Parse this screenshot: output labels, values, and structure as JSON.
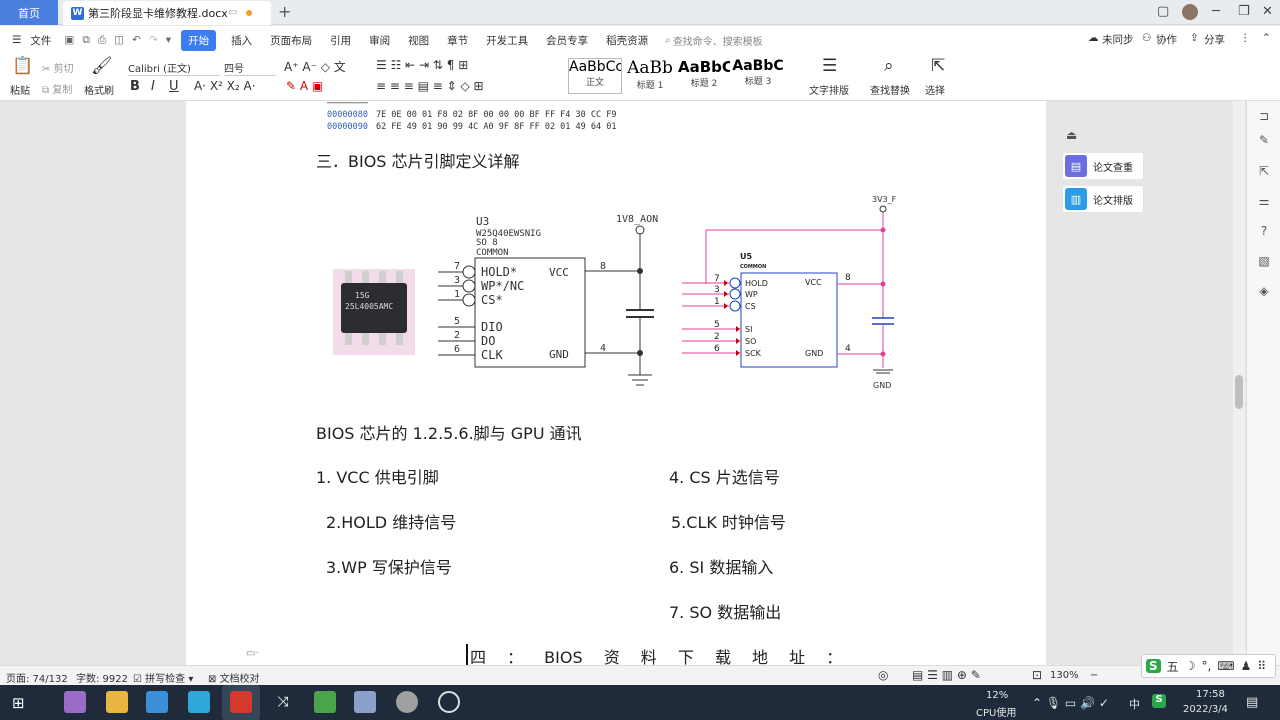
{
  "titlebar": {
    "home_tab": "首页",
    "doc_tab": "第三阶段显卡维修教程.docx",
    "doc_icon": "W",
    "new_tab": "+"
  },
  "menubar": {
    "file": "文件",
    "items": [
      "开始",
      "插入",
      "页面布局",
      "引用",
      "审阅",
      "视图",
      "章节",
      "开发工具",
      "会员专享",
      "稻壳资源"
    ],
    "search_placeholder": "查找命令、搜索模板",
    "unsync": "未同步",
    "collab": "协作",
    "share": "分享"
  },
  "ribbon": {
    "paste": "粘贴",
    "cut": "剪切",
    "copy": "复制",
    "format_painter": "格式刷",
    "font_name": "Calibri (正文)",
    "font_size": "四号",
    "styles": [
      {
        "preview": "AaBbCcI",
        "label": "正文"
      },
      {
        "preview": "AaBb",
        "label": "标题 1"
      },
      {
        "preview": "AaBbC",
        "label": "标题 2"
      },
      {
        "preview": "AaBbC",
        "label": "标题 3"
      }
    ],
    "text_layout": "文字排版",
    "find_replace": "查找替换",
    "select": "选择"
  },
  "document": {
    "hex_rows": [
      {
        "addr": "00000080",
        "bytes": "7E 0E 00 01 F8 02 8F 00  00 00 BF FF F4 30 CC F9"
      },
      {
        "addr": "00000090",
        "bytes": "62 FE 49 01 90 99 4C A0  9F 8F FF 02 01 49 64 01"
      }
    ],
    "heading3": "三．BIOS 芯片引脚定义详解",
    "chip_marking_1": "15G",
    "chip_marking_2": "25L4005AMC",
    "schem_left": {
      "ref": "U3",
      "part": "W25Q40EWSNIG",
      "pkg": "SO 8",
      "common": "COMMON",
      "net": "1V8_AON",
      "pins_left": [
        {
          "num": "7",
          "name": "HOLD*"
        },
        {
          "num": "3",
          "name": "WP*/NC"
        },
        {
          "num": "1",
          "name": "CS*"
        },
        {
          "num": "5",
          "name": "DIO"
        },
        {
          "num": "2",
          "name": "DO"
        },
        {
          "num": "6",
          "name": "CLK"
        }
      ],
      "vcc": "VCC",
      "vcc_pin": "8",
      "gnd": "GND",
      "gnd_pin": "4"
    },
    "schem_right": {
      "ref": "U5",
      "common": "COMMON",
      "net": "3V3_F",
      "gnd_net": "GND",
      "pins_left": [
        {
          "num": "7",
          "name": "HOLD"
        },
        {
          "num": "3",
          "name": "WP"
        },
        {
          "num": "1",
          "name": "CS"
        },
        {
          "num": "5",
          "name": "SI"
        },
        {
          "num": "2",
          "name": "SO"
        },
        {
          "num": "6",
          "name": "SCK"
        }
      ],
      "vcc": "VCC",
      "vcc_pin": "8",
      "gnd": "GND",
      "gnd_pin": "4"
    },
    "gpu_line": "BIOS 芯片的 1.2.5.6.脚与 GPU 通讯",
    "pin_list_left": [
      "1. VCC 供电引脚",
      "2.HOLD  维持信号",
      "3.WP  写保护信号"
    ],
    "pin_list_right": [
      "4. CS  片选信号",
      "5.CLK  时钟信号",
      "6. SI  数据输入",
      "7. SO 数据输出"
    ],
    "heading4": "四  ：  BIOS  资  料  下  载  地  址  ："
  },
  "side_panel": {
    "thesis_check": "论文查重",
    "thesis_format": "论文排版"
  },
  "statusbar": {
    "page": "页面: 74/132",
    "words": "字数: 9922",
    "spell": "拼写检查",
    "doc_check": "文档校对",
    "zoom": "130%"
  },
  "taskbar": {
    "cpu_pct": "12%",
    "cpu_label": "CPU使用",
    "ime_lang": "中",
    "time": "17:58",
    "date": "2022/3/4"
  },
  "ime": {
    "char": "五"
  },
  "colors": {
    "accent": "#3b7df0",
    "home_tab": "#4a7fe0",
    "schem_pink": "#e0409a",
    "schem_blue": "#2040c0",
    "taskbar": "#1f2b3a"
  }
}
